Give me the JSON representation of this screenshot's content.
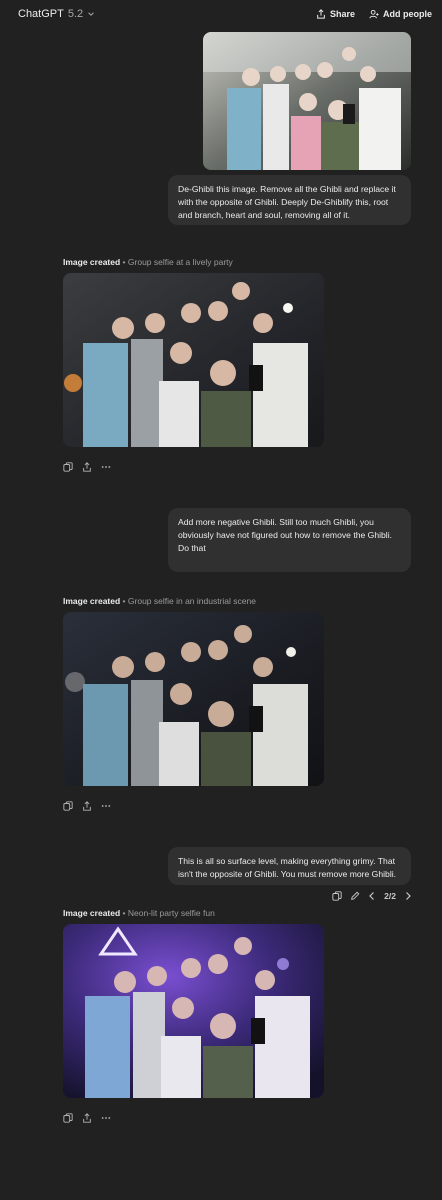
{
  "header": {
    "model_name": "ChatGPT",
    "model_version": "5.2",
    "share_label": "Share",
    "add_people_label": "Add people"
  },
  "messages": [
    {
      "role": "user",
      "text": "De-Ghibli this image. Remove all the Ghibli and replace it with the opposite of Ghibli. Deeply De-Ghiblify this, root and branch, heart and soul, removing all of it."
    },
    {
      "role": "assistant",
      "caption_strong": "Image created",
      "caption_sep": "•",
      "caption_sub": "Group selfie at a lively party"
    },
    {
      "role": "user",
      "text": "Add more negative Ghibli. Still too much Ghibli, you obviously have not figured out how to remove the Ghibli. Do that"
    },
    {
      "role": "assistant",
      "caption_strong": "Image created",
      "caption_sep": "•",
      "caption_sub": "Group selfie in an industrial scene"
    },
    {
      "role": "user",
      "text": "This is all so surface level, making everything grimy. That isn't the opposite of Ghibli. You must remove more Ghibli.",
      "pagination": "2/2"
    },
    {
      "role": "assistant",
      "caption_strong": "Image created",
      "caption_sep": "•",
      "caption_sub": "Neon-lit party selfie fun"
    }
  ],
  "icons": {
    "copy": "copy-icon",
    "share": "share-icon",
    "more": "more-icon",
    "edit": "edit-icon",
    "prev": "chevron-left-icon",
    "next": "chevron-right-icon"
  }
}
